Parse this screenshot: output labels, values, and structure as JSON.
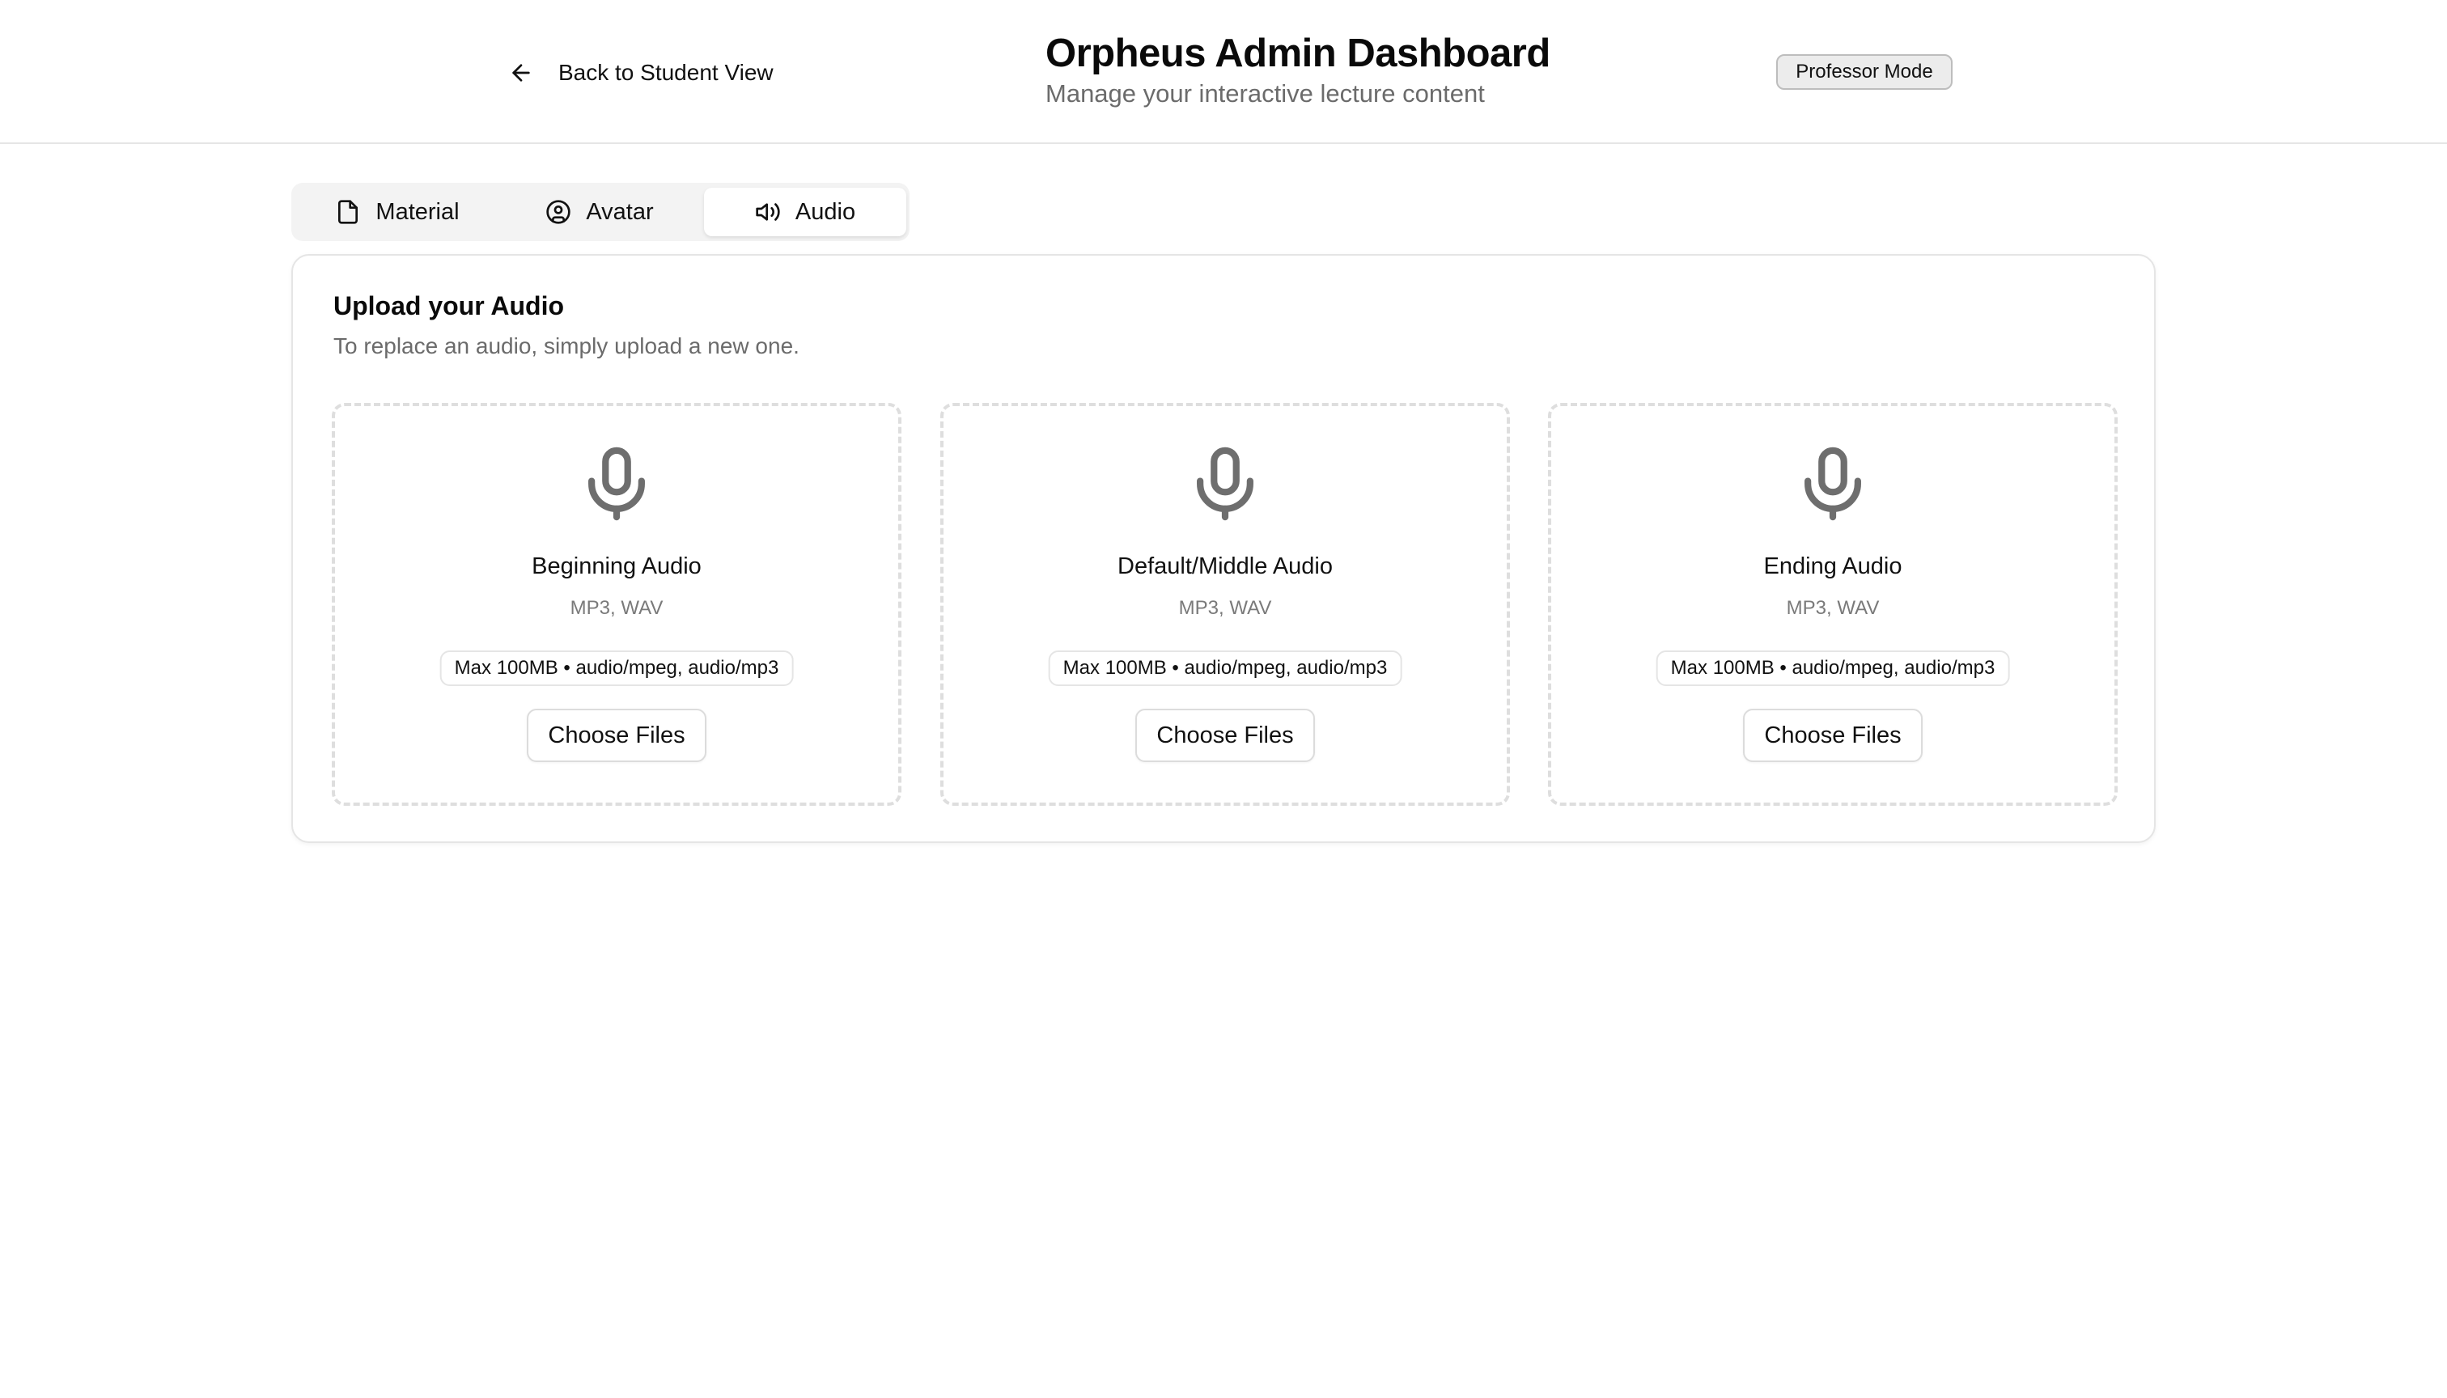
{
  "header": {
    "back_label": "Back to Student View",
    "title": "Orpheus Admin Dashboard",
    "subtitle": "Manage your interactive lecture content",
    "mode_badge": "Professor Mode"
  },
  "tabs": [
    {
      "label": "Material",
      "icon": "file-icon",
      "active": false
    },
    {
      "label": "Avatar",
      "icon": "user-circle-icon",
      "active": false
    },
    {
      "label": "Audio",
      "icon": "speaker-icon",
      "active": true
    }
  ],
  "upload": {
    "title": "Upload your Audio",
    "description": "To replace an audio, simply upload a new one.",
    "slots": [
      {
        "label": "Beginning Audio",
        "formats": "MP3, WAV",
        "limits": "Max 100MB • audio/mpeg, audio/mp3",
        "button": "Choose Files",
        "icon": "microphone-icon"
      },
      {
        "label": "Default/Middle Audio",
        "formats": "MP3, WAV",
        "limits": "Max 100MB • audio/mpeg, audio/mp3",
        "button": "Choose Files",
        "icon": "microphone-icon"
      },
      {
        "label": "Ending Audio",
        "formats": "MP3, WAV",
        "limits": "Max 100MB • audio/mpeg, audio/mp3",
        "button": "Choose Files",
        "icon": "microphone-icon"
      }
    ]
  },
  "colors": {
    "text": "#111111",
    "muted": "#6b6b6b",
    "border": "#e5e5e5",
    "icon_gray": "#6e6e6e",
    "tab_bg": "#f3f3f3"
  }
}
